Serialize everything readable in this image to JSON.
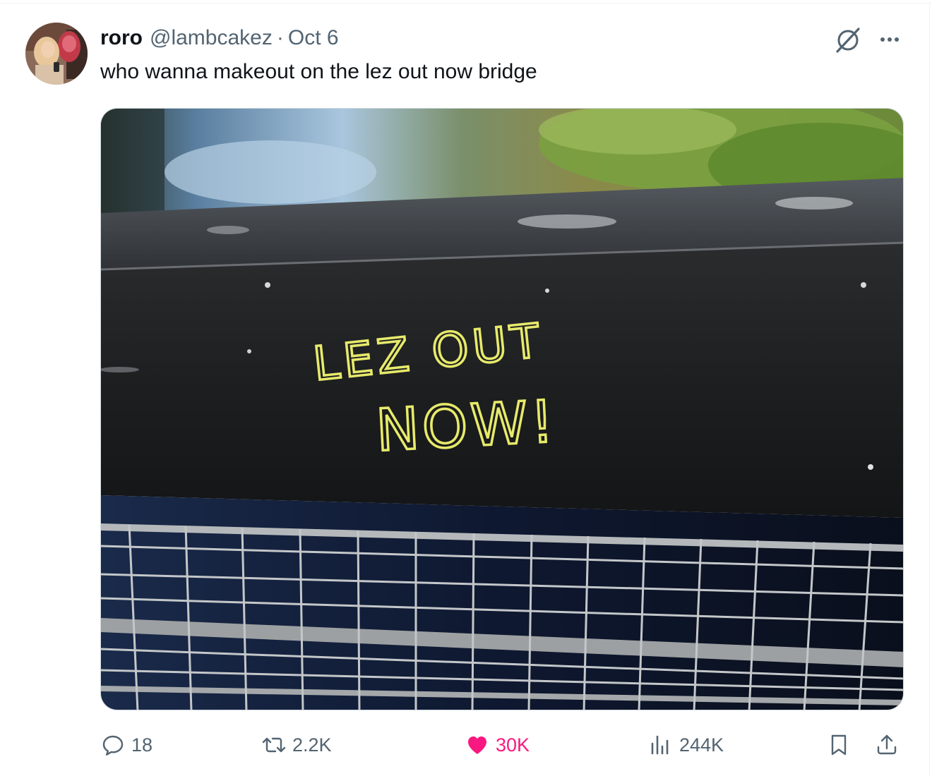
{
  "tweet": {
    "author_name": "roro",
    "author_handle": "@lambcakez",
    "separator": "·",
    "date": "Oct 6",
    "text": "who wanna makeout on the lez out now bridge"
  },
  "media": {
    "graffiti_line1": "LEZ OUT",
    "graffiti_line2": "NOW!"
  },
  "actions": {
    "replies": "18",
    "reposts": "2.2K",
    "likes": "30K",
    "views": "244K"
  },
  "icons": {
    "reply": "reply-icon",
    "repost": "repost-icon",
    "like": "heart-icon",
    "views": "views-icon",
    "bookmark": "bookmark-icon",
    "share": "share-icon",
    "grok": "grok-icon",
    "more": "more-icon"
  },
  "colors": {
    "like_active": "#f91880",
    "secondary_text": "#536471",
    "primary_text": "#0f1419",
    "graffiti": "#e7ea6a"
  }
}
